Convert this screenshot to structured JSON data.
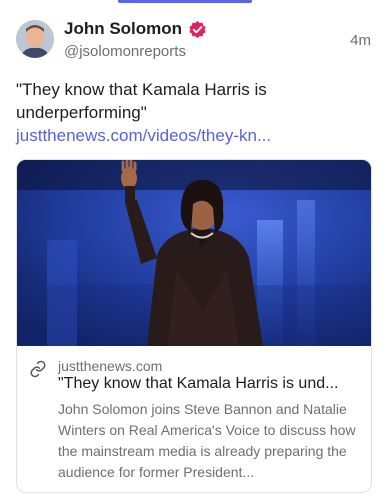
{
  "author": {
    "name": "John Solomon",
    "handle": "@jsolomonreports",
    "verified_icon": "verified-badge-icon",
    "verified_color": "#e0245e"
  },
  "post": {
    "time": "4m",
    "text": "\"They know that Kamala Harris is underperforming\" ",
    "link_text": "justthenews.com/videos/they-kn..."
  },
  "link_card": {
    "image_alt": "Kamala Harris waving on stage",
    "domain": "justthenews.com",
    "title": "\"They know that Kamala Harris is und...",
    "description": "John Solomon joins Steve Bannon and Natalie Winters on Real America's Voice to discuss how the mainstream media is already preparing the audience for former President..."
  },
  "colors": {
    "accent": "#5b63e8",
    "link": "#5a5fe0",
    "muted": "#6e6e73"
  }
}
